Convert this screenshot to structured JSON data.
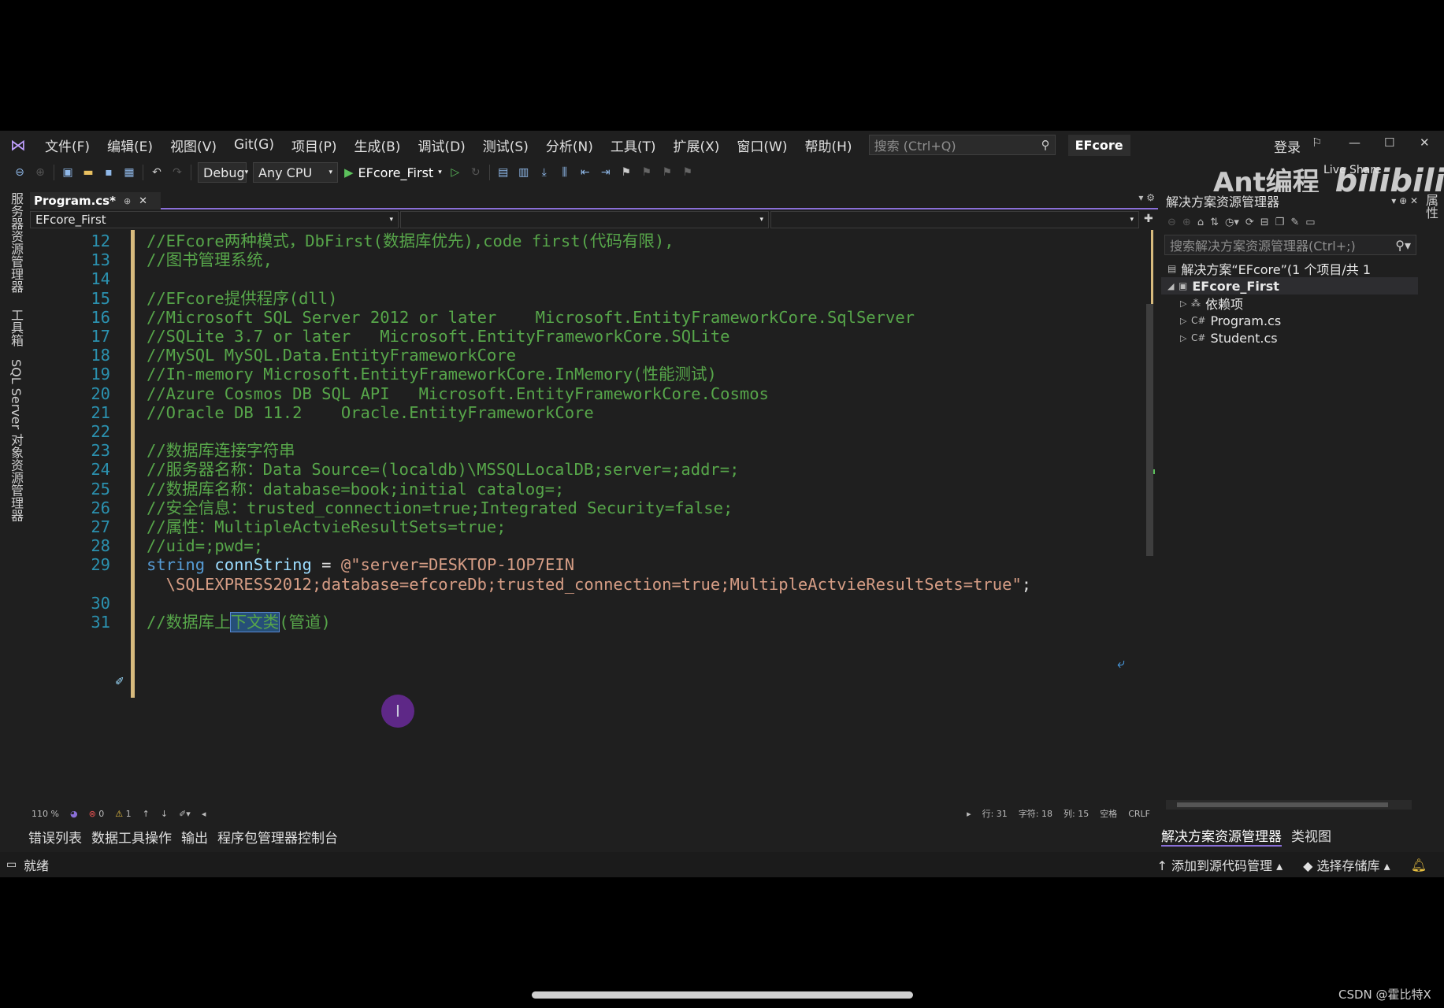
{
  "menu": [
    "文件(F)",
    "编辑(E)",
    "视图(V)",
    "Git(G)",
    "项目(P)",
    "生成(B)",
    "调试(D)",
    "测试(S)",
    "分析(N)",
    "工具(T)",
    "扩展(X)",
    "窗口(W)",
    "帮助(H)"
  ],
  "search_placeholder": "搜索 (Ctrl+Q)",
  "solution_badge": "EFcore",
  "login_label": "登录",
  "toolbar": {
    "config": "Debug",
    "platform": "Any CPU",
    "run_target": "EFcore_First"
  },
  "watermark": {
    "text": "Ant编程",
    "liveshare": "Live Share",
    "bilibili": "bilibili"
  },
  "left_rail": [
    "服务器资源管理器",
    "工具箱",
    "SQL Server 对象资源管理器"
  ],
  "right_rail": "属性",
  "tab": {
    "label": "Program.cs*",
    "pin": "⊕",
    "close": "✕"
  },
  "nav": {
    "project": "EFcore_First"
  },
  "code_lines": [
    {
      "n": "12",
      "tokens": [
        {
          "t": "//EFcore两种模式，DbFirst(数据库优先),code first(代码有限),",
          "c": "cmt"
        }
      ]
    },
    {
      "n": "13",
      "tokens": [
        {
          "t": "//图书管理系统,",
          "c": "cmt"
        }
      ]
    },
    {
      "n": "14",
      "tokens": []
    },
    {
      "n": "15",
      "tokens": [
        {
          "t": "//EFcore提供程序(dll)",
          "c": "cmt"
        }
      ]
    },
    {
      "n": "16",
      "tokens": [
        {
          "t": "//Microsoft SQL Server 2012 or later    Microsoft.EntityFrameworkCore.SqlServer",
          "c": "cmt"
        }
      ]
    },
    {
      "n": "17",
      "tokens": [
        {
          "t": "//SQLite 3.7 or later   Microsoft.EntityFrameworkCore.SQLite",
          "c": "cmt"
        }
      ]
    },
    {
      "n": "18",
      "tokens": [
        {
          "t": "//MySQL MySQL.Data.EntityFrameworkCore",
          "c": "cmt"
        }
      ]
    },
    {
      "n": "19",
      "tokens": [
        {
          "t": "//In-memory Microsoft.EntityFrameworkCore.InMemory(性能测试)",
          "c": "cmt"
        }
      ]
    },
    {
      "n": "20",
      "tokens": [
        {
          "t": "//Azure Cosmos DB SQL API   Microsoft.EntityFrameworkCore.Cosmos",
          "c": "cmt"
        }
      ]
    },
    {
      "n": "21",
      "tokens": [
        {
          "t": "//Oracle DB 11.2    Oracle.EntityFrameworkCore",
          "c": "cmt"
        }
      ]
    },
    {
      "n": "22",
      "tokens": []
    },
    {
      "n": "23",
      "tokens": [
        {
          "t": "//数据库连接字符串",
          "c": "cmt"
        }
      ]
    },
    {
      "n": "24",
      "tokens": [
        {
          "t": "//服务器名称：Data Source=(localdb)\\MSSQLLocalDB;server=;addr=;",
          "c": "cmt"
        }
      ]
    },
    {
      "n": "25",
      "tokens": [
        {
          "t": "//数据库名称：database=book;initial catalog=;",
          "c": "cmt"
        }
      ]
    },
    {
      "n": "26",
      "tokens": [
        {
          "t": "//安全信息：trusted_connection=true;Integrated Security=false;",
          "c": "cmt"
        }
      ]
    },
    {
      "n": "27",
      "tokens": [
        {
          "t": "//属性：MultipleActvieResultSets=true;",
          "c": "cmt"
        }
      ]
    },
    {
      "n": "28",
      "tokens": [
        {
          "t": "//uid=;pwd=;",
          "c": "cmt"
        }
      ]
    },
    {
      "n": "29",
      "tokens": [
        {
          "t": "string",
          "c": "kw"
        },
        {
          "t": " ",
          "c": ""
        },
        {
          "t": "connString",
          "c": "var"
        },
        {
          "t": " = ",
          "c": ""
        },
        {
          "t": "@\"server=DESKTOP-1OP7EIN",
          "c": "str"
        }
      ]
    },
    {
      "n": "",
      "tokens": [
        {
          "t": "  \\SQLEXPRESS2012;database=efcoreDb;trusted_connection=true;MultipleActvieResultSets=true\"",
          "c": "str"
        },
        {
          "t": ";",
          "c": ""
        }
      ]
    },
    {
      "n": "30",
      "tokens": []
    },
    {
      "n": "31",
      "tokens": [
        {
          "t": "//数据库上",
          "c": "cmt"
        },
        {
          "t": "下文类",
          "c": "sel"
        },
        {
          "t": "(管道)",
          "c": "cmt"
        }
      ]
    }
  ],
  "editor_status": {
    "zoom": "110 %",
    "errors": "0",
    "warnings": "1",
    "line": "行: 31",
    "char": "字符: 18",
    "col": "列: 15",
    "spacing": "空格",
    "eol": "CRLF"
  },
  "bottom_tabs": [
    "错误列表",
    "数据工具操作",
    "输出",
    "程序包管理器控制台"
  ],
  "status": {
    "ready": "就绪",
    "add_source_control": "添加到源代码管理",
    "select_repo": "选择存储库"
  },
  "solution_explorer": {
    "title": "解决方案资源管理器",
    "search": "搜索解决方案资源管理器(Ctrl+;)",
    "items": [
      {
        "label": "解决方案“EFcore”(1 个项目/共 1",
        "icon": "sln"
      },
      {
        "label": "EFcore_First",
        "icon": "proj"
      },
      {
        "label": "依赖项",
        "icon": "deps"
      },
      {
        "label": "Program.cs",
        "icon": "cs"
      },
      {
        "label": "Student.cs",
        "icon": "cs"
      }
    ],
    "tabs": [
      "解决方案资源管理器",
      "类视图"
    ]
  },
  "csdn_watermark": "CSDN @霍比特X"
}
